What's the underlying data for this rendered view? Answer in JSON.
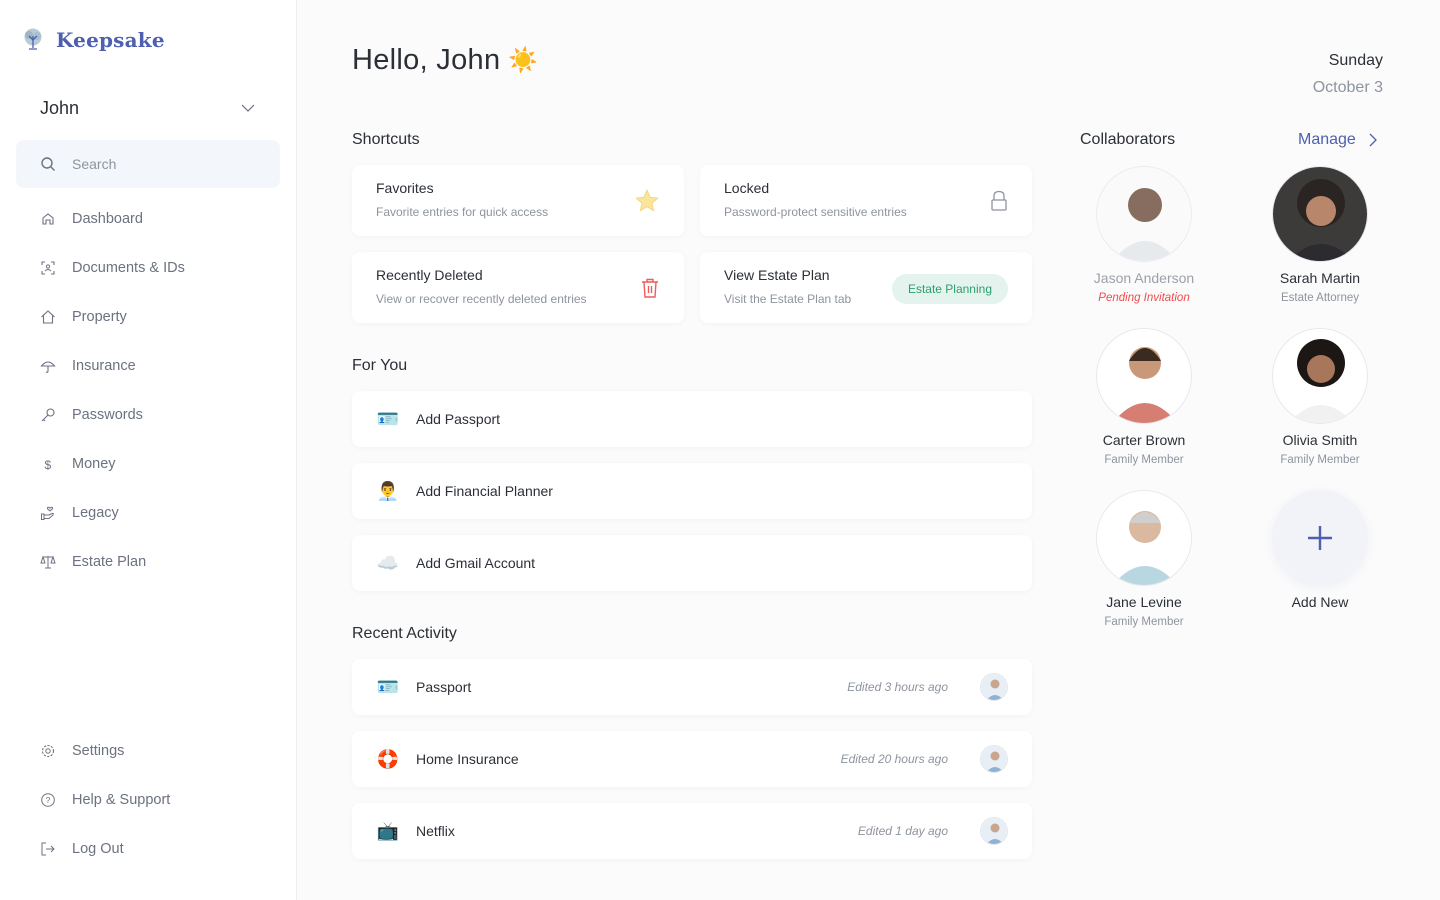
{
  "app": {
    "name": "Keepsake"
  },
  "sidebar": {
    "user": "John",
    "search": {
      "placeholder": "Search",
      "value": ""
    },
    "items": [
      {
        "label": "Dashboard",
        "icon": "home-icon"
      },
      {
        "label": "Documents & IDs",
        "icon": "id-scan-icon"
      },
      {
        "label": "Property",
        "icon": "house-icon"
      },
      {
        "label": "Insurance",
        "icon": "umbrella-icon"
      },
      {
        "label": "Passwords",
        "icon": "key-icon"
      },
      {
        "label": "Money",
        "icon": "dollar-icon"
      },
      {
        "label": "Legacy",
        "icon": "hand-heart-icon"
      },
      {
        "label": "Estate Plan",
        "icon": "scales-icon"
      }
    ],
    "footer": [
      {
        "label": "Settings",
        "icon": "gear-icon"
      },
      {
        "label": "Help & Support",
        "icon": "help-icon"
      },
      {
        "label": "Log Out",
        "icon": "logout-icon"
      }
    ]
  },
  "header": {
    "greeting": "Hello, John",
    "greeting_emoji": "☀️",
    "day": "Sunday",
    "date": "October 3"
  },
  "shortcuts": {
    "title": "Shortcuts",
    "items": [
      {
        "title": "Favorites",
        "desc": "Favorite entries for quick access",
        "icon": "star-icon"
      },
      {
        "title": "Locked",
        "desc": "Password-protect sensitive entries",
        "icon": "lock-icon"
      },
      {
        "title": "Recently Deleted",
        "desc": "View or recover recently deleted entries",
        "icon": "trash-icon"
      },
      {
        "title": "View Estate Plan",
        "desc": "Visit the Estate Plan tab",
        "badge": "Estate Planning"
      }
    ]
  },
  "for_you": {
    "title": "For You",
    "items": [
      {
        "label": "Add Passport",
        "emoji": "🪪"
      },
      {
        "label": "Add Financial Planner",
        "emoji": "👨‍💼"
      },
      {
        "label": "Add Gmail Account",
        "emoji": "☁️"
      }
    ]
  },
  "recent": {
    "title": "Recent Activity",
    "items": [
      {
        "label": "Passport",
        "emoji": "🪪",
        "meta": "Edited 3 hours ago"
      },
      {
        "label": "Home Insurance",
        "emoji": "🛟",
        "meta": "Edited 20 hours ago"
      },
      {
        "label": "Netflix",
        "emoji": "📺",
        "meta": "Edited 1 day ago"
      }
    ]
  },
  "collaborators": {
    "title": "Collaborators",
    "manage_label": "Manage",
    "people": [
      {
        "name": "Jason Anderson",
        "role": "Pending Invitation",
        "pending": true
      },
      {
        "name": "Sarah Martin",
        "role": "Estate Attorney"
      },
      {
        "name": "Carter Brown",
        "role": "Family Member"
      },
      {
        "name": "Olivia Smith",
        "role": "Family Member"
      },
      {
        "name": "Jane Levine",
        "role": "Family Member"
      }
    ],
    "add_label": "Add New"
  },
  "colors": {
    "accent": "#4d5fae",
    "danger": "#ef4c4c",
    "success": "#2d9e6f",
    "star": "#f8dc7a"
  }
}
